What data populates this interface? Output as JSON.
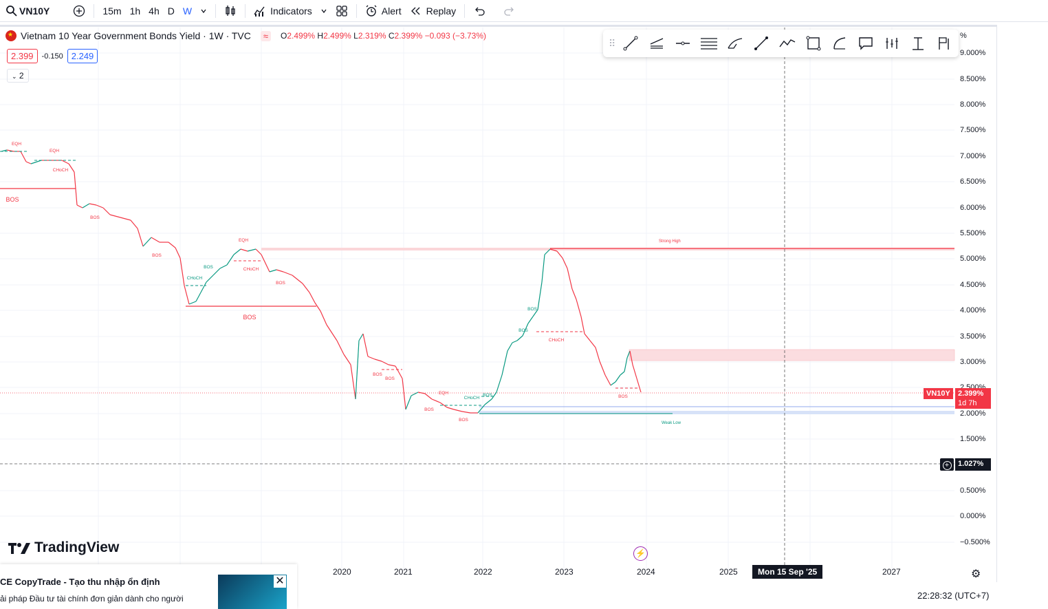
{
  "toolbar": {
    "symbol": "VN10Y",
    "intervals": [
      "15m",
      "1h",
      "4h",
      "D",
      "W"
    ],
    "active_interval": "W",
    "indicators_label": "Indicators",
    "alert_label": "Alert",
    "replay_label": "Replay"
  },
  "legend": {
    "title": "Vietnam 10 Year Government Bonds Yield · 1W · TVC",
    "o_label": "O",
    "o_val": "2.499%",
    "h_label": "H",
    "h_val": "2.499%",
    "l_label": "L",
    "l_val": "2.319%",
    "c_label": "C",
    "c_val": "2.399%",
    "change": "−0.093 (−3.73%)",
    "bid": "2.399",
    "spread": "-0.150",
    "ask": "2.249",
    "indicator_count": "2"
  },
  "drawing_tools": [
    "trend-line-icon",
    "channel-icon",
    "horizontal-line-icon",
    "parallel-lines-icon",
    "brush-icon",
    "arrow-line-icon",
    "path-icon",
    "rectangle-icon",
    "curve-icon",
    "callout-icon",
    "bars-pattern-icon",
    "long-position-icon",
    "flag-icon"
  ],
  "y_axis": {
    "ticks": [
      "9.000%",
      "8.500%",
      "8.000%",
      "7.500%",
      "7.000%",
      "6.500%",
      "6.000%",
      "5.500%",
      "5.000%",
      "4.500%",
      "4.000%",
      "3.500%",
      "3.000%",
      "2.500%",
      "2.000%",
      "1.500%",
      "1.027%",
      "0.500%",
      "0.000%",
      "−0.500%"
    ],
    "partial_top": "%"
  },
  "x_axis": {
    "ticks": [
      "2020",
      "2021",
      "2022",
      "2023",
      "2024",
      "2025",
      "2027"
    ],
    "cursor_date": "Mon 15 Sep '25"
  },
  "price_tag": {
    "symbol": "VN10Y",
    "value": "2.399%",
    "countdown": "1d 7h"
  },
  "crosshair_price": "1.027%",
  "annotations": {
    "eqh": "EQH",
    "choch": "CHoCH",
    "bos": "BOS",
    "strong_high": "Strong High",
    "weak_low": "Weak Low"
  },
  "brand": "TradingView",
  "ad": {
    "title": "CE CopyTrade - Tạo thu nhập ổn định",
    "body": "ải pháp Đầu tư tài chính đơn giản dành cho người",
    "close": "✕"
  },
  "clock": "22:28:32 (UTC+7)",
  "colors": {
    "up": "#089981",
    "down": "#f23645",
    "accent": "#2962ff",
    "bos_red": "#f23645",
    "choch_green": "#089981"
  }
}
